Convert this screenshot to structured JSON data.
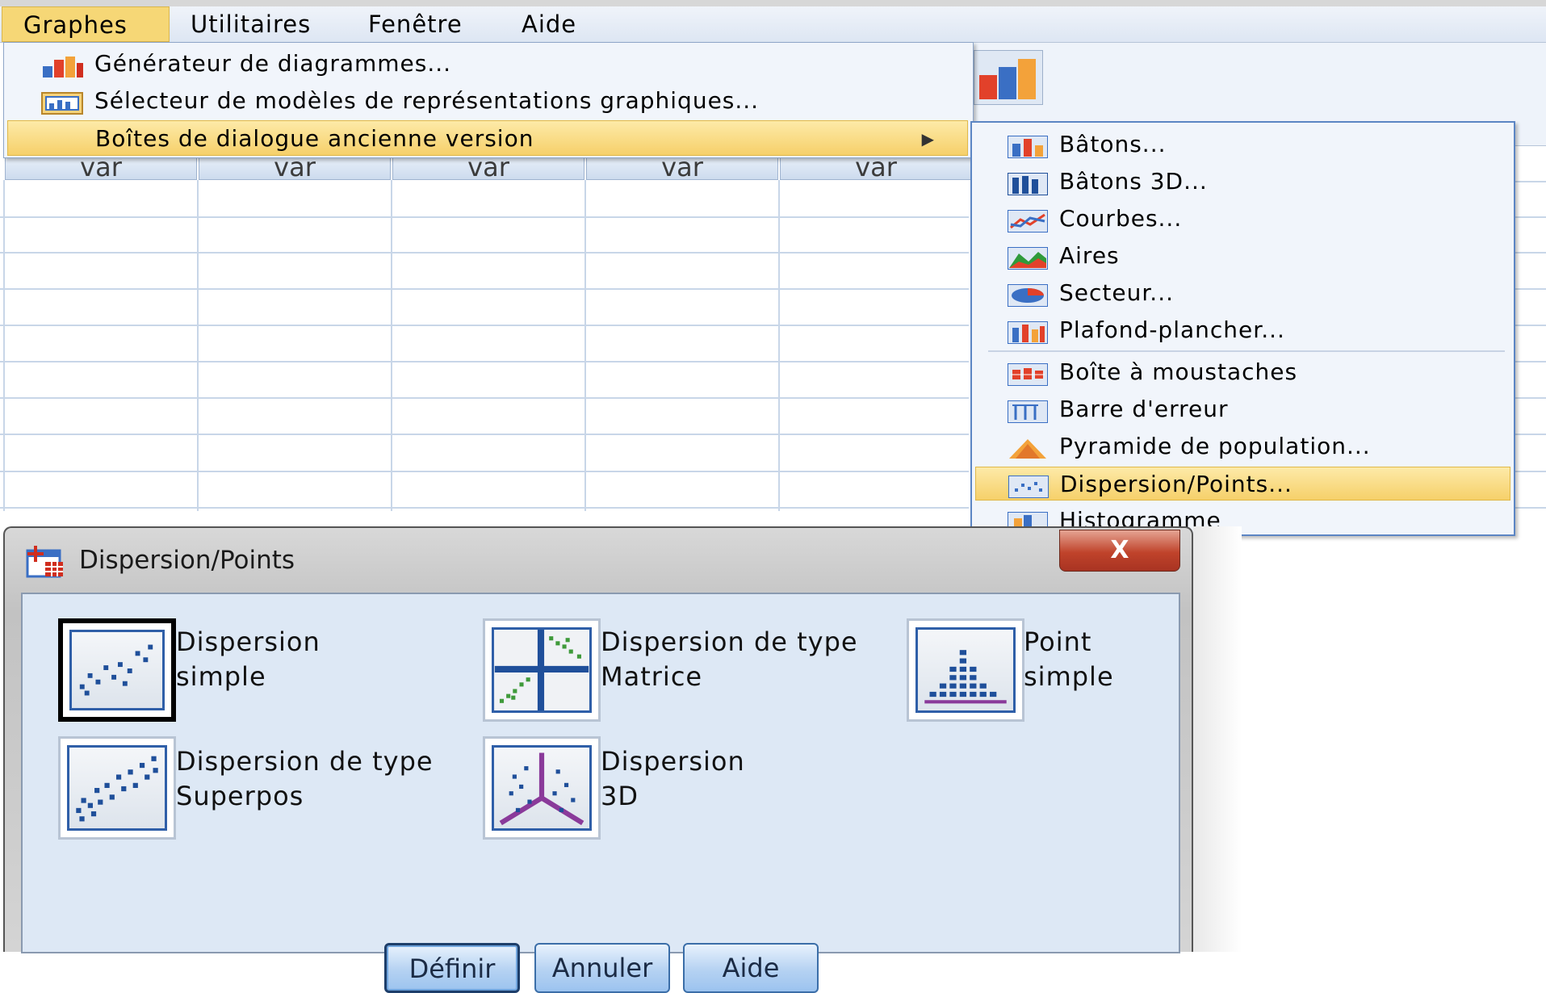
{
  "menubar": {
    "items": [
      {
        "label": "Graphes",
        "active": true
      },
      {
        "label": "Utilitaires",
        "active": false
      },
      {
        "label": "Fenêtre",
        "active": false
      },
      {
        "label": "Aide",
        "active": false
      }
    ]
  },
  "sheet": {
    "column_headers": [
      "var",
      "var",
      "var",
      "var",
      "var"
    ]
  },
  "graph_menu": {
    "items": [
      {
        "label": "Générateur de diagrammes...",
        "icon": "chart-builder-icon",
        "highlighted": false
      },
      {
        "label": "Sélecteur de modèles de représentations graphiques...",
        "icon": "template-chooser-icon",
        "highlighted": false
      },
      {
        "label": "Boîtes de dialogue ancienne version",
        "icon": "",
        "highlighted": true,
        "has_submenu": true
      }
    ]
  },
  "legacy_submenu": {
    "items": [
      {
        "label": "Bâtons...",
        "icon": "bar-chart-icon"
      },
      {
        "label": "Bâtons 3D...",
        "icon": "3d-bar-icon"
      },
      {
        "label": "Courbes...",
        "icon": "line-chart-icon"
      },
      {
        "label": "Aires",
        "icon": "area-chart-icon"
      },
      {
        "label": "Secteur...",
        "icon": "pie-chart-icon"
      },
      {
        "label": "Plafond-plancher...",
        "icon": "high-low-icon"
      },
      {
        "label": "Boîte à moustaches",
        "icon": "boxplot-icon"
      },
      {
        "label": "Barre d'erreur",
        "icon": "error-bar-icon"
      },
      {
        "label": "Pyramide de population...",
        "icon": "population-pyramid-icon"
      },
      {
        "label": "Dispersion/Points...",
        "icon": "scatter-dot-icon",
        "highlighted": true
      },
      {
        "label": "Histogramme",
        "icon": "histogram-icon",
        "partially_hidden": true
      }
    ]
  },
  "dialog": {
    "title": "Dispersion/Points",
    "close_label": "X",
    "options": [
      {
        "line1": "Dispersion",
        "line2": "simple",
        "icon": "simple-scatter-icon",
        "selected": true
      },
      {
        "line1": "Dispersion de type",
        "line2": "Matrice",
        "icon": "matrix-scatter-icon",
        "selected": false
      },
      {
        "line1": "Point",
        "line2": "simple",
        "icon": "simple-dot-icon",
        "selected": false
      },
      {
        "line1": "Dispersion de type",
        "line2": "Superpos",
        "icon": "overlay-scatter-icon",
        "selected": false
      },
      {
        "line1": "Dispersion",
        "line2": "3D",
        "icon": "3d-scatter-icon",
        "selected": false
      }
    ],
    "buttons": {
      "define": "Définir",
      "cancel": "Annuler",
      "help": "Aide"
    }
  },
  "colors": {
    "highlight": "#f6d06a",
    "menu_bg": "#f1f5fb",
    "dialog_body": "#dde8f5",
    "button_blue": "#9cc3ef",
    "close_red": "#c0432b"
  }
}
